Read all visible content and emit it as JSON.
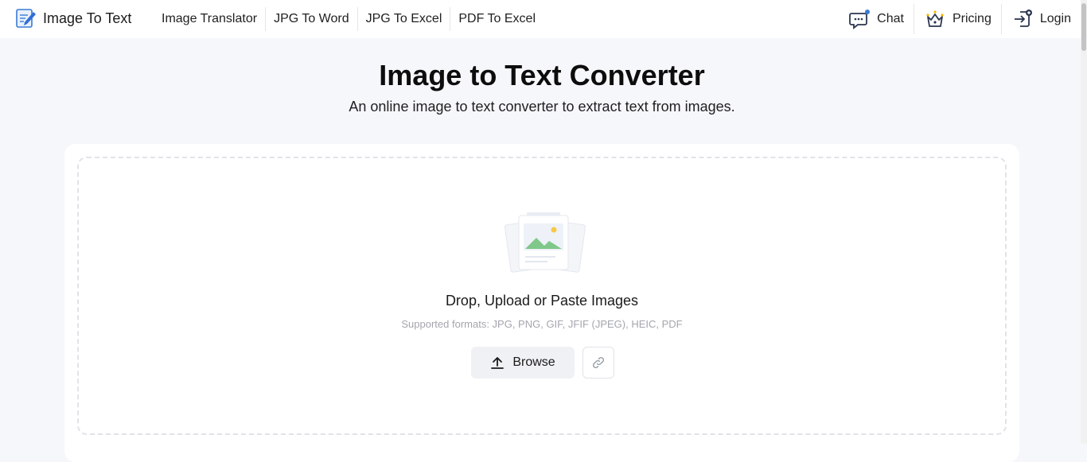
{
  "brand": {
    "name": "Image To Text",
    "icon": "notepad-pencil-icon",
    "accent": "#2f6fd6"
  },
  "nav": {
    "links": [
      {
        "label": "Image Translator"
      },
      {
        "label": "JPG To Word"
      },
      {
        "label": "JPG To Excel"
      },
      {
        "label": "PDF To Excel"
      }
    ],
    "actions": {
      "chat": {
        "label": "Chat",
        "icon": "chat-bubble-icon"
      },
      "pricing": {
        "label": "Pricing",
        "icon": "crown-icon"
      },
      "login": {
        "label": "Login",
        "icon": "login-icon"
      }
    }
  },
  "hero": {
    "title": "Image to Text Converter",
    "subtitle": "An online image to text converter to extract text from images."
  },
  "upload": {
    "title": "Drop, Upload or Paste Images",
    "formats": "Supported formats: JPG, PNG, GIF, JFIF (JPEG), HEIC, PDF",
    "browse_label": "Browse",
    "browse_icon": "upload-arrow-icon",
    "link_icon": "link-icon",
    "illustration_icon": "image-stack-icon"
  }
}
